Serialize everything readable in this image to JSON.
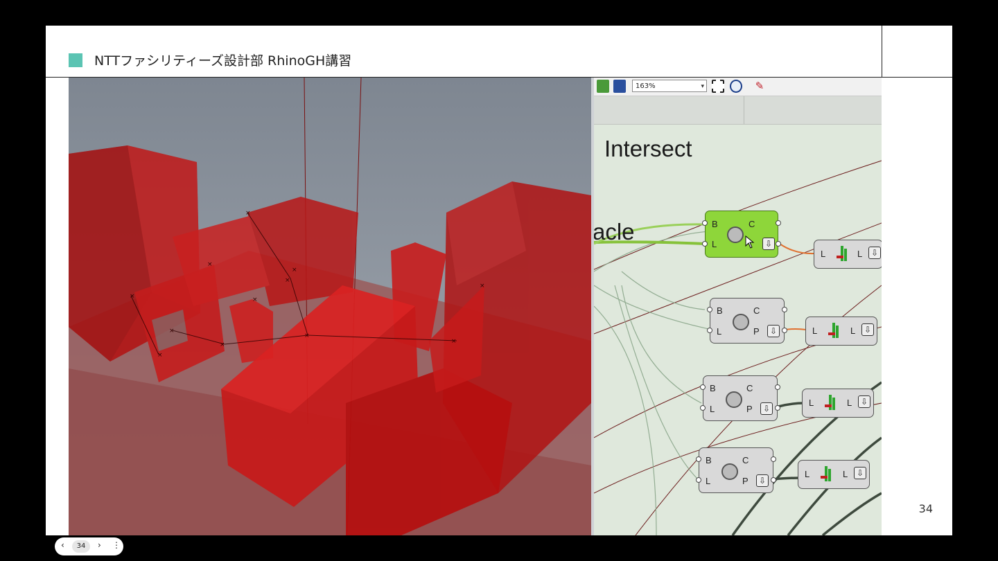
{
  "slide": {
    "title": "NTTファシリティーズ設計部 RhinoGH講習",
    "page_number": "34",
    "accent_color": "#5bc4b3"
  },
  "grasshopper": {
    "zoom": "163%",
    "section_title": "Intersect",
    "partial_label": "acle",
    "components": [
      {
        "inputs": [
          "B",
          "L"
        ],
        "outputs": [
          "C",
          ""
        ],
        "selected": true
      },
      {
        "inputs": [
          "B",
          "L"
        ],
        "outputs": [
          "C",
          "P"
        ],
        "selected": false
      },
      {
        "inputs": [
          "B",
          "L"
        ],
        "outputs": [
          "C",
          "P"
        ],
        "selected": false
      },
      {
        "inputs": [
          "B",
          "L"
        ],
        "outputs": [
          "C",
          "P"
        ],
        "selected": false
      }
    ],
    "cull_components": [
      {
        "input": "L",
        "output": "L"
      },
      {
        "input": "L",
        "output": "L"
      },
      {
        "input": "L",
        "output": "L"
      },
      {
        "input": "L",
        "output": "L"
      }
    ],
    "download_glyph": "⇩"
  },
  "viewer": {
    "prev": "‹",
    "next": "›",
    "page": "34",
    "menu": "⋮"
  }
}
